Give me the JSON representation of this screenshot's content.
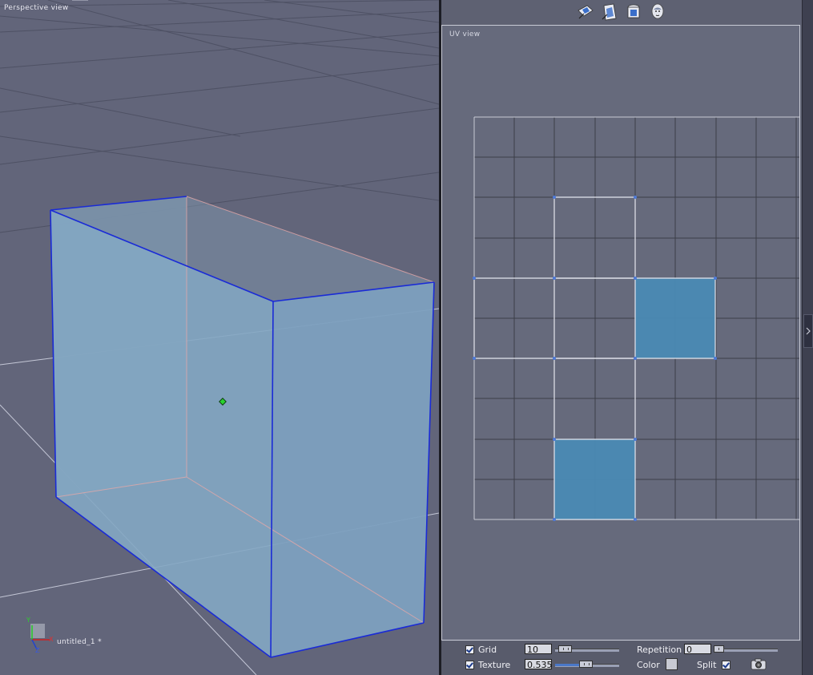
{
  "perspective_view": {
    "title": "Perspective view",
    "object_name": "untitled_1 *",
    "axes": {
      "y": "Y",
      "x": "X",
      "z": "Z"
    }
  },
  "toolbar": {
    "icons": [
      "uv-planar-icon",
      "uv-box-icon",
      "uv-cylinder-icon",
      "uv-sphere-head-icon"
    ]
  },
  "uv_view": {
    "title": "UV view",
    "grid_divisions": 10,
    "selected_faces_color": "#4a8ab4"
  },
  "bottom_bar": {
    "grid_label": "Grid",
    "grid_value": "10",
    "grid_checked": true,
    "repetition_label": "Repetition",
    "repetition_value": "0",
    "texture_label": "Texture",
    "texture_value": "0.535",
    "texture_checked": true,
    "color_label": "Color",
    "split_label": "Split",
    "split_checked": true
  },
  "colors": {
    "viewport_bg": "#62657a",
    "mesh_fill": "#8fb4d0",
    "edge_selected": "#1a2bd6"
  }
}
